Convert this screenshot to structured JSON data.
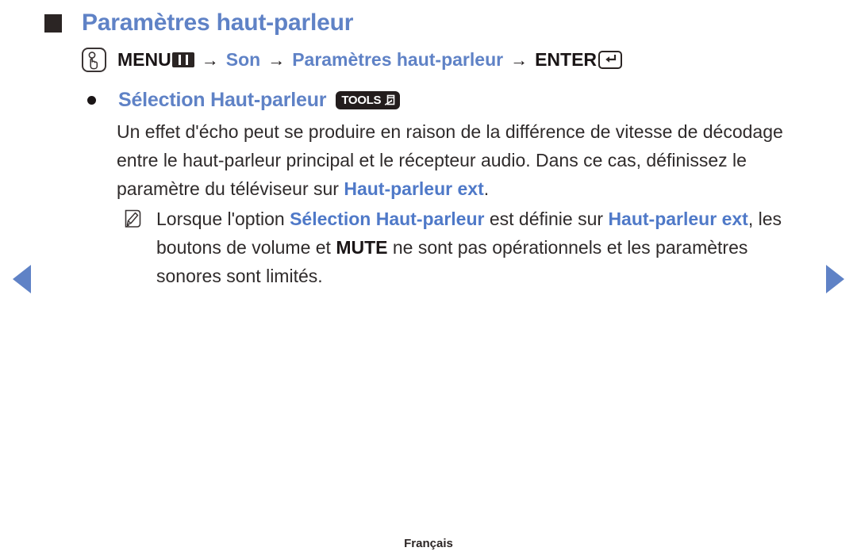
{
  "page": {
    "title": "Paramètres haut-parleur",
    "language_footer": "Français",
    "accent_blue": "#5f82c6",
    "text_blue": "#4f79c8",
    "text_dark": "#2f2b2b"
  },
  "menu_path": {
    "touch_icon": "touch-hand-icon",
    "menu_label": "MENU",
    "menu_icon": "menu-bars-icon",
    "arrow": "→",
    "step_son": "Son",
    "step_settings": "Paramètres haut-parleur",
    "enter_label": "ENTER",
    "enter_icon": "enter-return-icon"
  },
  "bullet": {
    "label": "Sélection Haut-parleur",
    "badge": "TOOLS",
    "badge_icon": "tools-window-icon"
  },
  "body": {
    "part1": "Un effet d'écho peut se produire en raison de la différence de vitesse de décodage entre le haut-parleur principal et le récepteur audio. Dans ce cas, définissez le paramètre du téléviseur sur ",
    "highlight1": "Haut-parleur ext",
    "part2": "."
  },
  "note": {
    "icon": "note-pencil-icon",
    "part1": "Lorsque l'option ",
    "highlight1": "Sélection Haut-parleur",
    "part2": " est définie sur ",
    "highlight2": "Haut-parleur ext",
    "part3": ", les boutons de volume et ",
    "bold1": "MUTE",
    "part4": " ne sont pas opérationnels et les paramètres sonores sont limités."
  },
  "nav": {
    "prev": "previous-page-arrow",
    "next": "next-page-arrow"
  }
}
